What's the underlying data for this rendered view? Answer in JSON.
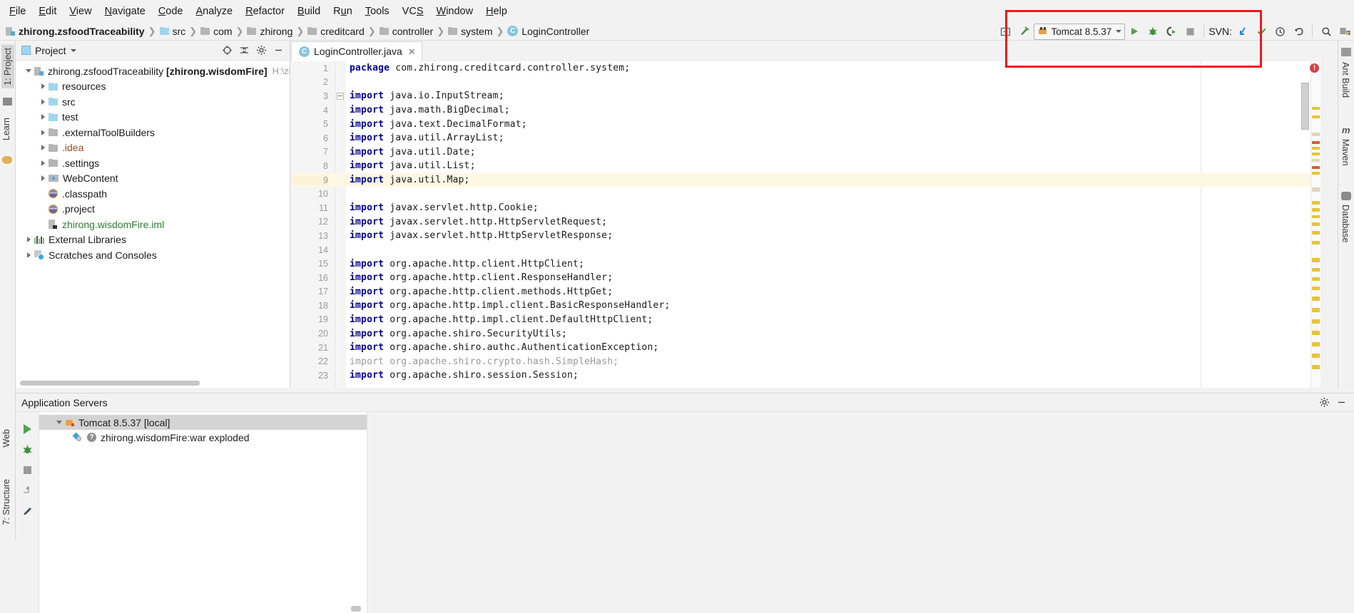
{
  "menubar": {
    "items": [
      "File",
      "Edit",
      "View",
      "Navigate",
      "Code",
      "Analyze",
      "Refactor",
      "Build",
      "Run",
      "Tools",
      "VCS",
      "Window",
      "Help"
    ]
  },
  "breadcrumb": {
    "items": [
      {
        "label": "zhirong.zsfoodTraceability",
        "icon": "module-icon",
        "bold": true
      },
      {
        "label": "src",
        "icon": "folder-icon-blue",
        "bold": false
      },
      {
        "label": "com",
        "icon": "folder-icon-gray",
        "bold": false
      },
      {
        "label": "zhirong",
        "icon": "folder-icon-gray",
        "bold": false
      },
      {
        "label": "creditcard",
        "icon": "folder-icon-gray",
        "bold": false
      },
      {
        "label": "controller",
        "icon": "folder-icon-gray",
        "bold": false
      },
      {
        "label": "system",
        "icon": "folder-icon-gray",
        "bold": false
      },
      {
        "label": "LoginController",
        "icon": "class-icon",
        "bold": false
      }
    ]
  },
  "toolbar": {
    "run_config": "Tomcat 8.5.37",
    "svn_label": "SVN:",
    "buttons": [
      {
        "name": "open-in-new-window-icon",
        "glyph": "▣"
      },
      {
        "name": "build-hammer-icon",
        "glyph": "⌃"
      },
      {
        "name": "run-button",
        "glyph": "▶"
      },
      {
        "name": "debug-button",
        "glyph": "✹"
      },
      {
        "name": "run-with-coverage-button",
        "glyph": "◧"
      },
      {
        "name": "stop-button",
        "glyph": "■"
      },
      {
        "name": "svn-update-icon",
        "glyph": "↙"
      },
      {
        "name": "svn-commit-icon",
        "glyph": "✓"
      },
      {
        "name": "svn-history-icon",
        "glyph": "◷"
      },
      {
        "name": "svn-rollback-icon",
        "glyph": "↺"
      },
      {
        "name": "search-everywhere-icon",
        "glyph": "⌕"
      },
      {
        "name": "project-structure-icon",
        "glyph": "▮"
      }
    ]
  },
  "left_strip": {
    "labels": [
      "1: Project",
      "Learn"
    ]
  },
  "left_strip_bottom": {
    "labels": [
      "Web",
      "7: Structure"
    ]
  },
  "right_strip": {
    "labels": [
      "Ant Build",
      "Maven",
      "Database"
    ]
  },
  "project_panel": {
    "title": "Project",
    "tree": [
      {
        "label": "zhirong.zsfoodTraceability",
        "bold_suffix": "[zhirong.wisdomFire]",
        "path_hint": "H:\\zhiron",
        "arrow": "open",
        "icon": "module-icon",
        "indent": 0,
        "color": "normal"
      },
      {
        "label": "resources",
        "arrow": "closed",
        "icon": "folder-icon-blue",
        "indent": 1,
        "color": "normal"
      },
      {
        "label": "src",
        "arrow": "closed",
        "icon": "folder-icon-blue",
        "indent": 1,
        "color": "normal"
      },
      {
        "label": "test",
        "arrow": "closed",
        "icon": "folder-icon-blue",
        "indent": 1,
        "color": "normal"
      },
      {
        "label": ".externalToolBuilders",
        "arrow": "closed",
        "icon": "folder-icon-gray",
        "indent": 1,
        "color": "normal"
      },
      {
        "label": ".idea",
        "arrow": "closed",
        "icon": "folder-icon-gray",
        "indent": 1,
        "color": "brown"
      },
      {
        "label": ".settings",
        "arrow": "closed",
        "icon": "folder-icon-gray",
        "indent": 1,
        "color": "normal"
      },
      {
        "label": "WebContent",
        "arrow": "closed",
        "icon": "web-folder-icon",
        "indent": 1,
        "color": "normal"
      },
      {
        "label": ".classpath",
        "arrow": "none",
        "icon": "xml-file-icon",
        "indent": 1,
        "color": "normal"
      },
      {
        "label": ".project",
        "arrow": "none",
        "icon": "xml-file-icon",
        "indent": 1,
        "color": "normal"
      },
      {
        "label": "zhirong.wisdomFire.iml",
        "arrow": "none",
        "icon": "iml-file-icon",
        "indent": 1,
        "color": "green"
      },
      {
        "label": "External Libraries",
        "arrow": "closed",
        "icon": "library-icon",
        "indent": 0,
        "color": "normal"
      },
      {
        "label": "Scratches and Consoles",
        "arrow": "closed",
        "icon": "scratches-icon",
        "indent": 0,
        "color": "normal"
      }
    ]
  },
  "editor": {
    "tab": {
      "label": "LoginController.java",
      "close": "✕"
    },
    "error_badge": "!",
    "lines": [
      {
        "n": "1",
        "segments": [
          {
            "t": "package",
            "c": "kw"
          },
          {
            "t": " com.zhirong.creditcard.controller.system;",
            "c": "pl"
          }
        ],
        "fold": false,
        "hl": false
      },
      {
        "n": "2",
        "segments": [],
        "fold": false,
        "hl": false
      },
      {
        "n": "3",
        "segments": [
          {
            "t": "import",
            "c": "kw"
          },
          {
            "t": " java.io.InputStream;",
            "c": "pl"
          }
        ],
        "fold": true,
        "hl": false
      },
      {
        "n": "4",
        "segments": [
          {
            "t": "import",
            "c": "kw"
          },
          {
            "t": " java.math.BigDecimal;",
            "c": "pl"
          }
        ],
        "fold": false,
        "hl": false
      },
      {
        "n": "5",
        "segments": [
          {
            "t": "import",
            "c": "kw"
          },
          {
            "t": " java.text.DecimalFormat;",
            "c": "pl"
          }
        ],
        "fold": false,
        "hl": false
      },
      {
        "n": "6",
        "segments": [
          {
            "t": "import",
            "c": "kw"
          },
          {
            "t": " java.util.ArrayList;",
            "c": "pl"
          }
        ],
        "fold": false,
        "hl": false
      },
      {
        "n": "7",
        "segments": [
          {
            "t": "import",
            "c": "kw"
          },
          {
            "t": " java.util.Date;",
            "c": "pl"
          }
        ],
        "fold": false,
        "hl": false
      },
      {
        "n": "8",
        "segments": [
          {
            "t": "import",
            "c": "kw"
          },
          {
            "t": " java.util.List;",
            "c": "pl"
          }
        ],
        "fold": false,
        "hl": false
      },
      {
        "n": "9",
        "segments": [
          {
            "t": "import",
            "c": "kw"
          },
          {
            "t": " java.util.Map;",
            "c": "pl"
          }
        ],
        "fold": false,
        "hl": true
      },
      {
        "n": "10",
        "segments": [],
        "fold": false,
        "hl": false
      },
      {
        "n": "11",
        "segments": [
          {
            "t": "import",
            "c": "kw"
          },
          {
            "t": " javax.servlet.http.Cookie;",
            "c": "pl"
          }
        ],
        "fold": false,
        "hl": false
      },
      {
        "n": "12",
        "segments": [
          {
            "t": "import",
            "c": "kw"
          },
          {
            "t": " javax.servlet.http.HttpServletRequest;",
            "c": "pl"
          }
        ],
        "fold": false,
        "hl": false
      },
      {
        "n": "13",
        "segments": [
          {
            "t": "import",
            "c": "kw"
          },
          {
            "t": " javax.servlet.http.HttpServletResponse;",
            "c": "pl"
          }
        ],
        "fold": false,
        "hl": false
      },
      {
        "n": "14",
        "segments": [],
        "fold": false,
        "hl": false
      },
      {
        "n": "15",
        "segments": [
          {
            "t": "import",
            "c": "kw"
          },
          {
            "t": " org.apache.http.client.HttpClient;",
            "c": "pl"
          }
        ],
        "fold": false,
        "hl": false
      },
      {
        "n": "16",
        "segments": [
          {
            "t": "import",
            "c": "kw"
          },
          {
            "t": " org.apache.http.client.ResponseHandler;",
            "c": "pl"
          }
        ],
        "fold": false,
        "hl": false
      },
      {
        "n": "17",
        "segments": [
          {
            "t": "import",
            "c": "kw"
          },
          {
            "t": " org.apache.http.client.methods.HttpGet;",
            "c": "pl"
          }
        ],
        "fold": false,
        "hl": false
      },
      {
        "n": "18",
        "segments": [
          {
            "t": "import",
            "c": "kw"
          },
          {
            "t": " org.apache.http.impl.client.BasicResponseHandler;",
            "c": "pl"
          }
        ],
        "fold": false,
        "hl": false
      },
      {
        "n": "19",
        "segments": [
          {
            "t": "import",
            "c": "kw"
          },
          {
            "t": " org.apache.http.impl.client.DefaultHttpClient;",
            "c": "pl"
          }
        ],
        "fold": false,
        "hl": false
      },
      {
        "n": "20",
        "segments": [
          {
            "t": "import",
            "c": "kw"
          },
          {
            "t": " org.apache.shiro.SecurityUtils;",
            "c": "pl"
          }
        ],
        "fold": false,
        "hl": false
      },
      {
        "n": "21",
        "segments": [
          {
            "t": "import",
            "c": "kw"
          },
          {
            "t": " org.apache.shiro.authc.AuthenticationException;",
            "c": "pl"
          }
        ],
        "fold": false,
        "hl": false
      },
      {
        "n": "22",
        "segments": [
          {
            "t": "import",
            "c": "dim"
          },
          {
            "t": " org.apache.shiro.crypto.hash.SimpleHash;",
            "c": "dim"
          }
        ],
        "fold": false,
        "hl": false
      },
      {
        "n": "23",
        "segments": [
          {
            "t": "import",
            "c": "kw"
          },
          {
            "t": " org.apache.shiro.session.Session;",
            "c": "pl"
          }
        ],
        "fold": false,
        "hl": false
      }
    ]
  },
  "bottom_panel": {
    "title": "Application Servers",
    "rows": [
      {
        "label": "Tomcat 8.5.37 [local]",
        "icon": "tomcat-icon",
        "indent": 0,
        "selected": true,
        "arrow": "open"
      },
      {
        "label": "zhirong.wisdomFire:war exploded",
        "icon": "war-artifact-icon",
        "indent": 1,
        "selected": false,
        "arrow": "none"
      }
    ],
    "gutter_buttons": [
      {
        "name": "rerun-button",
        "glyph": "▶"
      },
      {
        "name": "debug-button",
        "glyph": "✹"
      },
      {
        "name": "stop-button",
        "glyph": "■"
      },
      {
        "name": "deploy-all-button",
        "glyph": "⇥"
      },
      {
        "name": "edit-configuration-button",
        "glyph": "✎"
      }
    ],
    "settings_glyph": "⚙",
    "hide_glyph": "—"
  }
}
